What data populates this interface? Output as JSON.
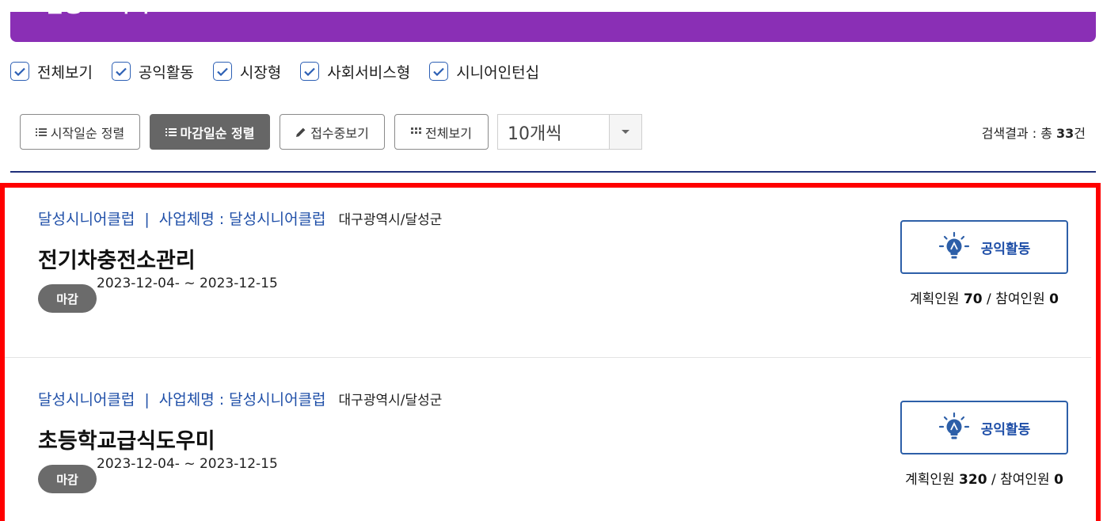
{
  "banner": {
    "title": "모집공고 목록",
    "color": "#8a2fb5"
  },
  "filters": [
    {
      "label": "전체보기",
      "checked": true
    },
    {
      "label": "공익활동",
      "checked": true
    },
    {
      "label": "시장형",
      "checked": true
    },
    {
      "label": "사회서비스형",
      "checked": true
    },
    {
      "label": "시니어인턴십",
      "checked": true
    }
  ],
  "toolbar": {
    "sort_start": "시작일순 정렬",
    "sort_end": "마감일순 정렬",
    "receiving": "접수중보기",
    "view_all": "전체보기",
    "page_size": "10개씩"
  },
  "result": {
    "prefix": "검색결과 : 총 ",
    "count": "33",
    "suffix": "건"
  },
  "listings": [
    {
      "org": "달성시니어클럽",
      "separator": "|",
      "business": "사업체명 : 달성시니어클럽",
      "region": "대구광역시/달성군",
      "title": "전기차충전소관리",
      "status": "마감",
      "period": "2023-12-04- ~ 2023-12-15",
      "type": "공익활동",
      "planned_label": "계획인원 ",
      "planned": "70",
      "slash": " / ",
      "participants_label": "참여인원 ",
      "participants": "0"
    },
    {
      "org": "달성시니어클럽",
      "separator": "|",
      "business": "사업체명 : 달성시니어클럽",
      "region": "대구광역시/달성군",
      "title": "초등학교급식도우미",
      "status": "마감",
      "period": "2023-12-04- ~ 2023-12-15",
      "type": "공익활동",
      "planned_label": "계획인원 ",
      "planned": "320",
      "slash": " / ",
      "participants_label": "참여인원 ",
      "participants": "0"
    }
  ],
  "colors": {
    "link": "#1f4fa8",
    "highlight": "#ff0000",
    "divider": "#1f2f7a"
  },
  "icons": {
    "check": "check-icon",
    "list": "list-icon",
    "pencil": "pencil-icon",
    "grid": "grid-icon",
    "caret": "caret-down-icon",
    "lightbulb": "lightbulb-icon"
  }
}
